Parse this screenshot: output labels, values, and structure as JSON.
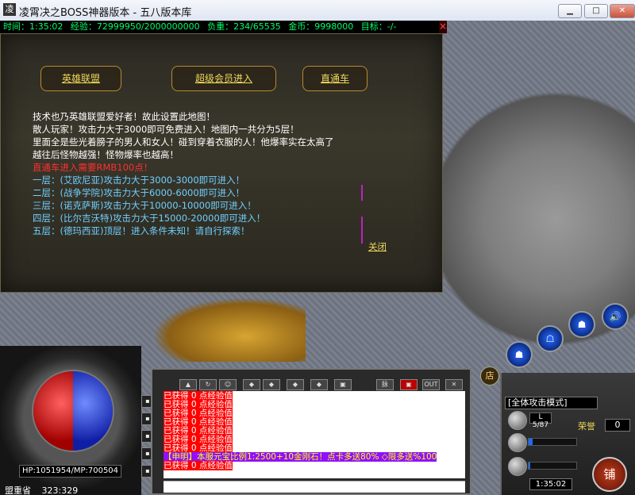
{
  "window": {
    "title": "凌霄决之BOSS神器版本 - 五八版本库",
    "minimize_label": "▁",
    "maximize_label": "□",
    "close_label": "✕"
  },
  "status": {
    "time": "时间：1:35:02",
    "exp": "经验：72999950/2000000000",
    "weight": "负重：234/65535",
    "gold": "金币：9998000",
    "target": "目标：-/-"
  },
  "npc": {
    "buttons": [
      "英雄联盟",
      "超级会员进入",
      "直通车"
    ],
    "lines": [
      {
        "text": "技术也乃英雄联盟爱好者！故此设置此地图！",
        "cls": ""
      },
      {
        "text": "散人玩家！攻击力大于3000即可免费进入！地图内一共分为5层！",
        "cls": ""
      },
      {
        "text": "里面全是些光着膀子的男人和女人！碰到穿着衣服的人！他爆率实在太高了",
        "cls": ""
      },
      {
        "text": "越往后怪物越强！怪物爆率也越高！",
        "cls": ""
      },
      {
        "text": "直通车进入需要RMB100点！",
        "cls": "red"
      },
      {
        "text": "一层：(艾欧尼亚)攻击力大于3000-3000即可进入！",
        "cls": "blue"
      },
      {
        "text": "二层：(战争学院)攻击力大于6000-6000即可进入！",
        "cls": "blue"
      },
      {
        "text": "三层：(诺克萨斯)攻击力大于10000-10000即可进入！",
        "cls": "blue"
      },
      {
        "text": "四层：(比尔吉沃特)攻击力大于15000-20000即可进入！",
        "cls": "blue"
      },
      {
        "text": "五层：(德玛西亚)顶层！进入条件未知！请自行探索！",
        "cls": "blue"
      }
    ],
    "close_label": "关闭"
  },
  "player": {
    "hp_mp": "HP:1051954/MP:700504",
    "map": "盟重省",
    "coords": "323:329",
    "hp_fraction": 1.0,
    "mp_fraction": 1.0
  },
  "chat": {
    "toolbar": [
      "脉",
      "▣",
      "OUT",
      "✕"
    ],
    "repeat_line": "已获得 0 点经验值",
    "announcement": "【申明】本服元宝比例1:2500+10金刚石！点卡多送80% ◇限多送%100"
  },
  "panel": {
    "mode": "[全体攻击模式]",
    "level": "L 5/87",
    "honor_label": "荣誉",
    "honor_value": "0",
    "time": "1:35:02",
    "shop": "铺",
    "shop_sign": "店"
  }
}
